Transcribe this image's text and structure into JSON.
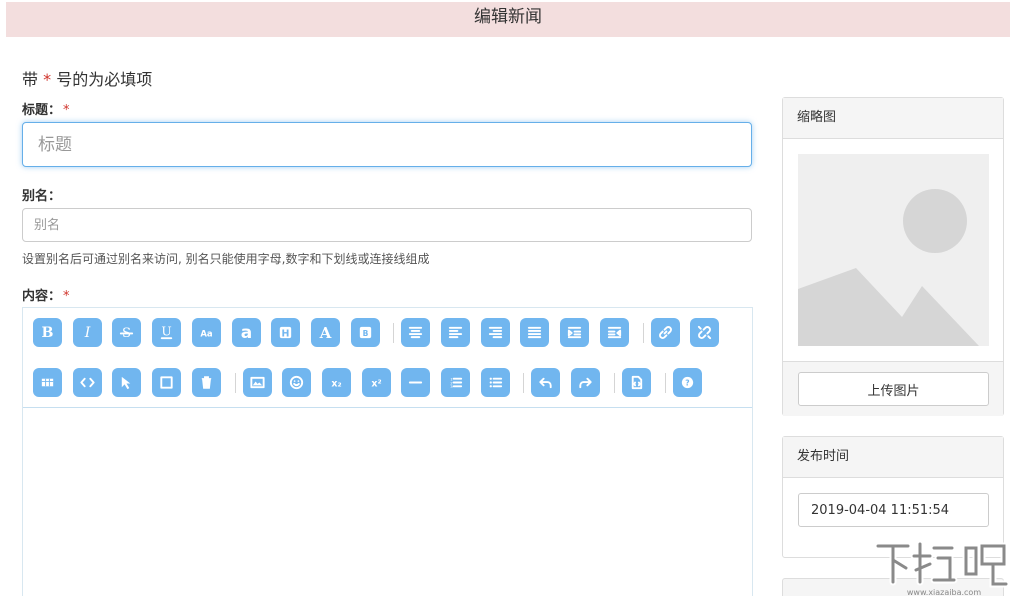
{
  "page": {
    "title": "编辑新闻"
  },
  "form": {
    "required_prefix": "带",
    "required_star": "*",
    "required_suffix": "号的为必填项",
    "title": {
      "label": "标题：",
      "placeholder": "标题",
      "value": ""
    },
    "alias": {
      "label": "别名：",
      "placeholder": "别名",
      "value": "",
      "help": "设置别名后可通过别名来访问, 别名只能使用字母,数字和下划线或连接线组成"
    },
    "content": {
      "label": "内容：",
      "value": ""
    }
  },
  "editor": {
    "accent_color": "#71b6ef",
    "toolbar_row1": [
      "bold-icon",
      "italic-icon",
      "strikethrough-icon",
      "underline-icon",
      "font-size-icon",
      "font-family-icon",
      "heading-icon",
      "font-color-icon",
      "background-color-icon",
      "|",
      "align-center-icon",
      "align-left-icon",
      "align-right-icon",
      "align-justify-icon",
      "indent-icon",
      "outdent-icon",
      "|",
      "link-icon",
      "unlink-icon"
    ],
    "toolbar_row2": [
      "insert-table-icon",
      "source-code-icon",
      "select-all-icon",
      "fullscreen-icon",
      "clear-icon",
      "|",
      "image-icon",
      "emoji-icon",
      "subscript-icon",
      "superscript-icon",
      "horizontal-rule-icon",
      "ordered-list-icon",
      "unordered-list-icon",
      "|",
      "undo-icon",
      "redo-icon",
      "|",
      "preview-icon",
      "|",
      "help-icon"
    ],
    "glyphs": {
      "font-size-icon": "Aa",
      "font-family-icon": "a",
      "heading-icon": "H",
      "font-color-icon": "A",
      "background-color-icon": "B",
      "subscript-icon": "x₂",
      "superscript-icon": "x²"
    }
  },
  "sidebar": {
    "thumbnail": {
      "title": "缩略图",
      "upload_label": "上传图片"
    },
    "publish": {
      "title": "发布时间",
      "value": "2019-04-04 11:51:54"
    }
  },
  "watermark": {
    "text": "下载吧",
    "url": "www.xiazaiba.com"
  },
  "colors": {
    "header_bg": "#f3dede",
    "required": "#d0332b",
    "focus": "#66afe9"
  }
}
